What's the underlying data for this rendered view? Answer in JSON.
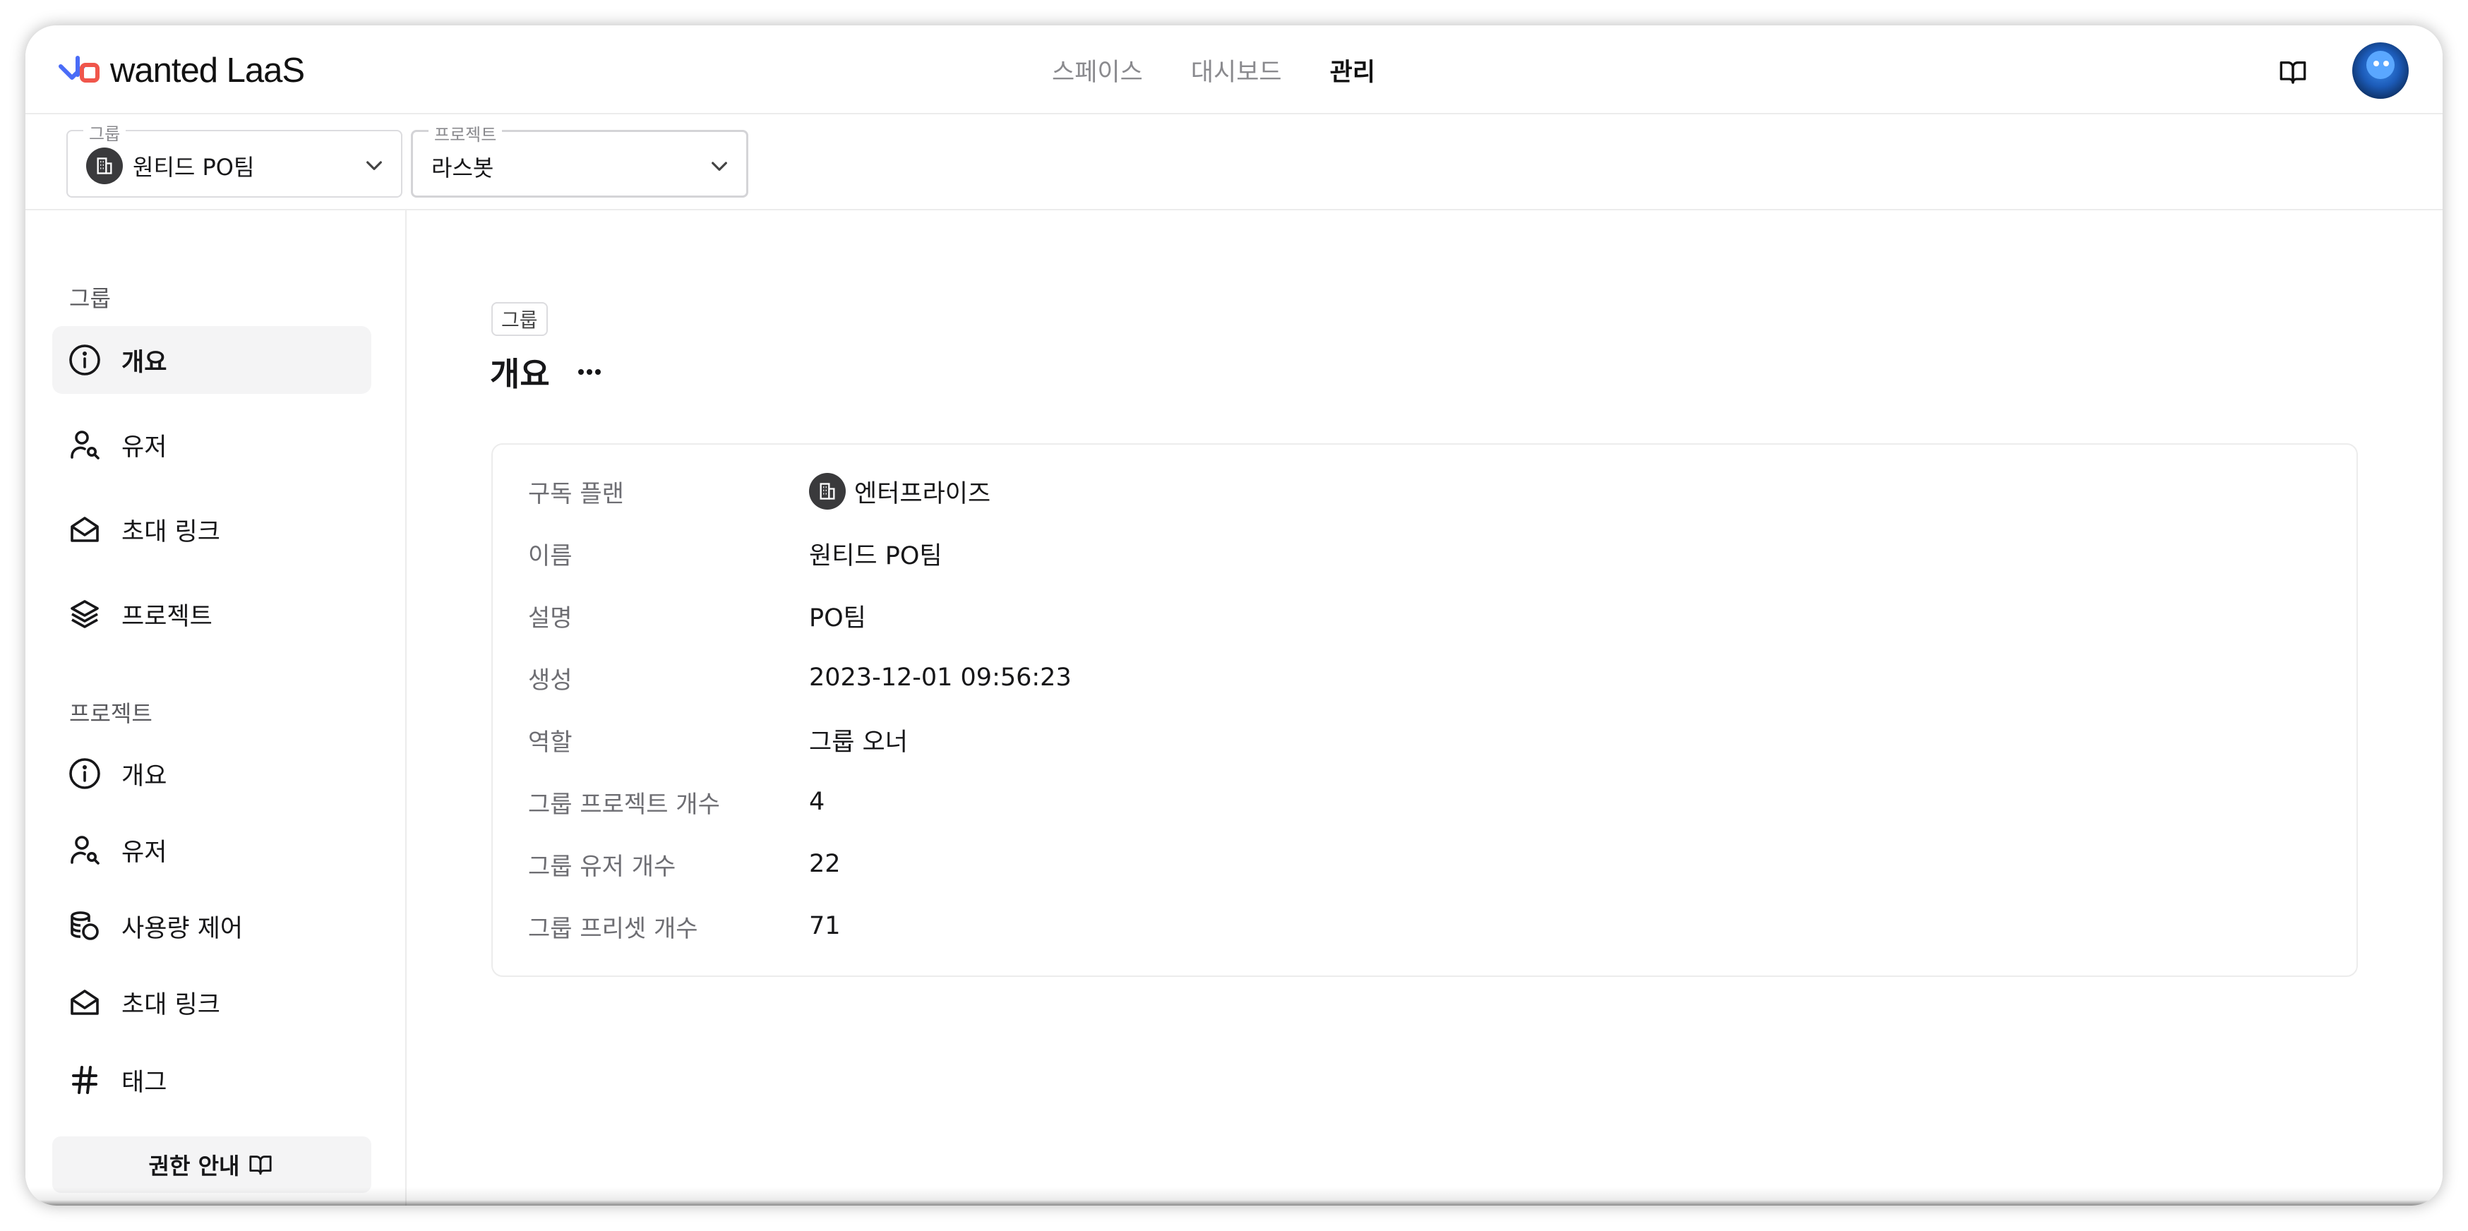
{
  "app": {
    "logo_text": "wanted LaaS",
    "nav": [
      {
        "label": "스페이스",
        "active": false
      },
      {
        "label": "대시보드",
        "active": false
      },
      {
        "label": "관리",
        "active": true
      }
    ],
    "icons": {
      "docs": "book-open-icon",
      "avatar": "user-avatar"
    }
  },
  "selectors": {
    "group": {
      "legend": "그룹",
      "value": "원티드 PO팀",
      "icon": "building-icon"
    },
    "project": {
      "legend": "프로젝트",
      "value": "라스봇"
    }
  },
  "sidebar": {
    "group_heading": "그룹",
    "group_items": [
      {
        "label": "개요",
        "icon": "info-icon",
        "selected": true
      },
      {
        "label": "유저",
        "icon": "user-search-icon",
        "selected": false
      },
      {
        "label": "초대 링크",
        "icon": "mail-open-icon",
        "selected": false
      },
      {
        "label": "프로젝트",
        "icon": "layers-icon",
        "selected": false
      }
    ],
    "project_heading": "프로젝트",
    "project_items": [
      {
        "label": "개요",
        "icon": "info-icon"
      },
      {
        "label": "유저",
        "icon": "user-search-icon"
      },
      {
        "label": "사용량 제어",
        "icon": "coins-icon"
      },
      {
        "label": "초대 링크",
        "icon": "mail-open-icon"
      },
      {
        "label": "태그",
        "icon": "hash-icon"
      }
    ],
    "permission_button": "권한 안내"
  },
  "main": {
    "breadcrumb": "그룹",
    "title": "개요",
    "details": [
      {
        "key": "구독 플랜",
        "value": "엔터프라이즈",
        "icon": "building-icon"
      },
      {
        "key": "이름",
        "value": "원티드 PO팀"
      },
      {
        "key": "설명",
        "value": "PO팀"
      },
      {
        "key": "생성",
        "value": "2023-12-01 09:56:23"
      },
      {
        "key": "역할",
        "value": "그룹 오너"
      },
      {
        "key": "그룹 프로젝트 개수",
        "value": "4"
      },
      {
        "key": "그룹 유저 개수",
        "value": "22"
      },
      {
        "key": "그룹 프리셋 개수",
        "value": "71"
      }
    ]
  },
  "colors": {
    "logo_blue": "#4a6cf7",
    "logo_red": "#f0564b",
    "selected_bg": "#f4f4f5",
    "border": "#ececec"
  }
}
